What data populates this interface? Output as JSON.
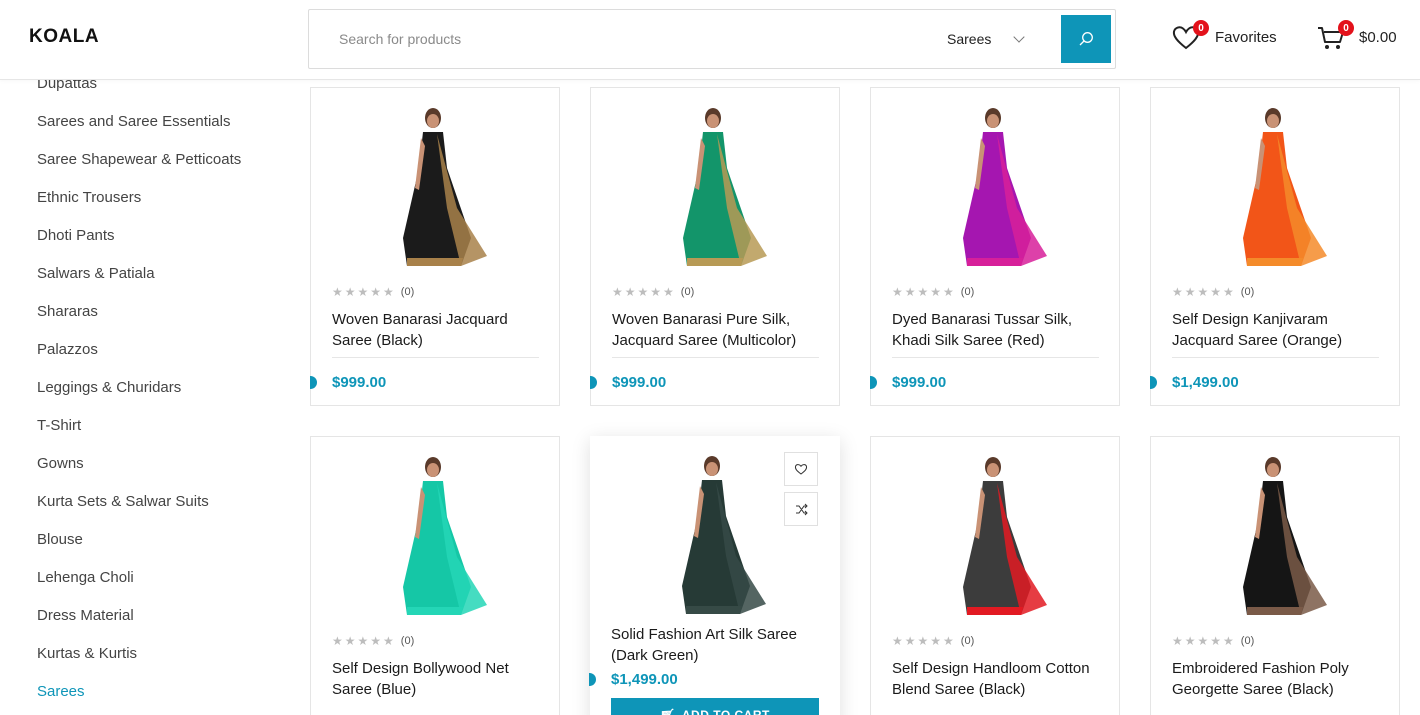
{
  "header": {
    "logo": "KOALA",
    "search_placeholder": "Search for products",
    "category_selected": "Sarees",
    "favorites_label": "Favorites",
    "favorites_count": "0",
    "cart_count": "0",
    "cart_total": "$0.00"
  },
  "sidebar": {
    "items": [
      {
        "label": "Dupattas"
      },
      {
        "label": "Sarees and Saree Essentials"
      },
      {
        "label": "Saree Shapewear & Petticoats"
      },
      {
        "label": "Ethnic Trousers"
      },
      {
        "label": "Dhoti Pants"
      },
      {
        "label": "Salwars & Patiala"
      },
      {
        "label": "Shararas"
      },
      {
        "label": "Palazzos"
      },
      {
        "label": "Leggings & Churidars"
      },
      {
        "label": "T-Shirt"
      },
      {
        "label": "Gowns"
      },
      {
        "label": "Kurta Sets & Salwar Suits"
      },
      {
        "label": "Blouse"
      },
      {
        "label": "Lehenga Choli"
      },
      {
        "label": "Dress Material"
      },
      {
        "label": "Kurtas & Kurtis"
      },
      {
        "label": "Sarees",
        "active": true
      }
    ]
  },
  "products": [
    {
      "name": "Woven Banarasi Jacquard Saree (Black)",
      "price": "$999.00",
      "rating_count": "(0)",
      "colors": [
        "#1b1b1b",
        "#a8814a"
      ]
    },
    {
      "name": "Woven Banarasi Pure Silk, Jacquard Saree (Multicolor)",
      "price": "$999.00",
      "rating_count": "(0)",
      "colors": [
        "#13956a",
        "#b79a55"
      ]
    },
    {
      "name": "Dyed Banarasi Tussar Silk, Khadi Silk Saree (Red)",
      "price": "$999.00",
      "rating_count": "(0)",
      "colors": [
        "#a516b0",
        "#d7209a"
      ]
    },
    {
      "name": "Self Design Kanjivaram Jacquard Saree (Orange)",
      "price": "$1,499.00",
      "rating_count": "(0)",
      "colors": [
        "#f25518",
        "#f48b2a"
      ]
    },
    {
      "name": "Self Design Bollywood Net Saree (Blue)",
      "price": "",
      "rating_count": "(0)",
      "colors": [
        "#15c7a6",
        "#24d6b6"
      ]
    },
    {
      "name": "Solid Fashion Art Silk Saree (Dark Green)",
      "price": "$1,499.00",
      "rating_count": "",
      "add_to_cart": "ADD TO CART",
      "colors": [
        "#263a36",
        "#364a46"
      ]
    },
    {
      "name": "Self Design Handloom Cotton Blend Saree (Black)",
      "price": "",
      "rating_count": "(0)",
      "colors": [
        "#3c3c3c",
        "#e21a22"
      ]
    },
    {
      "name": "Embroidered Fashion Poly Georgette Saree (Black)",
      "price": "",
      "rating_count": "(0)",
      "colors": [
        "#151515",
        "#7a5a48"
      ]
    }
  ]
}
